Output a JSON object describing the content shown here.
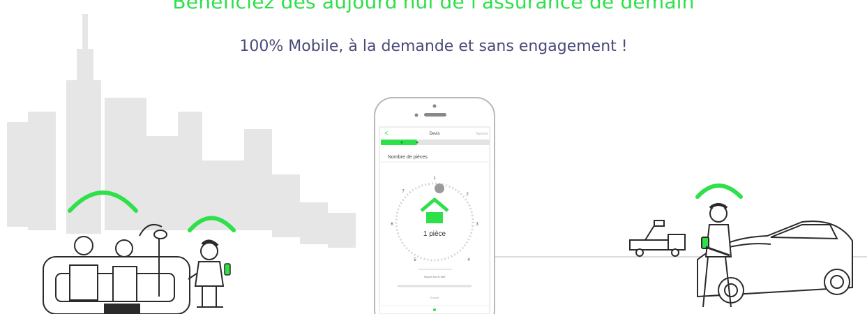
{
  "hero": {
    "headline": "Bénéficiez dès aujourd'hui de l'assurance de demain",
    "subline": "100% Mobile, à la demande et sans engagement !"
  },
  "phone": {
    "header_title": "Devis",
    "header_action": "Suivant",
    "back_icon": "chevron-left-icon",
    "progress": 0.33,
    "question": "Nombre de pièces",
    "dial_numbers": [
      "1",
      "2",
      "3",
      "4",
      "5",
      "6",
      "7"
    ],
    "selected_value": "1 pièce",
    "selected_icon": "house-icon",
    "footer_text": "Impact sur le tarif",
    "footer_caption": "Endroit"
  },
  "colors": {
    "accent": "#2ee04a",
    "subtitle": "#4a4a78",
    "skyline": "#e6e6e6",
    "ink": "#2a2a2a"
  }
}
